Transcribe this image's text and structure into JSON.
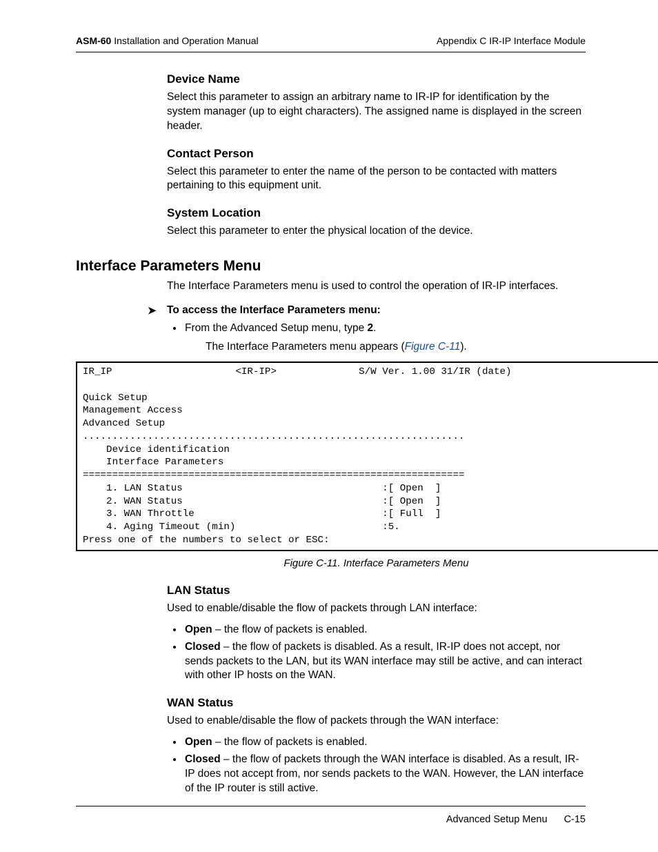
{
  "header": {
    "product": "ASM-60",
    "doc_title": "Installation and Operation Manual",
    "appendix": "Appendix C  IR-IP Interface Module"
  },
  "sections": {
    "device_name": {
      "title": "Device Name",
      "body": "Select this parameter to assign an arbitrary name to IR-IP for identification by the system manager (up to eight characters). The assigned name is displayed in the screen header."
    },
    "contact_person": {
      "title": "Contact Person",
      "body": "Select this parameter to enter the name of the person to be contacted with matters pertaining to this equipment unit."
    },
    "system_location": {
      "title": "System Location",
      "body": "Select this parameter to enter the physical location of the device."
    },
    "interface_params": {
      "title": "Interface Parameters Menu",
      "intro": "The Interface Parameters menu is used to control the operation of IR-IP interfaces.",
      "access_title": "To access the Interface Parameters menu:",
      "step_prefix": "From the Advanced Setup menu, type ",
      "step_key": "2",
      "step_suffix": ".",
      "result_prefix": "The Interface Parameters menu appears (",
      "figure_link": "Figure C-11",
      "result_suffix": ")."
    },
    "figure_caption": "Figure C-11.  Interface Parameters Menu",
    "lan_status": {
      "title": "LAN Status",
      "intro": "Used to enable/disable the flow of packets through LAN interface:",
      "open_term": "Open",
      "open_body": " – the flow of packets is enabled.",
      "closed_term": "Closed",
      "closed_body": " – the flow of packets is disabled. As a result, IR-IP does not accept, nor sends packets to the LAN, but its WAN interface may still be active, and can interact with other IP hosts on the WAN."
    },
    "wan_status": {
      "title": "WAN Status",
      "intro": "Used to enable/disable the flow of packets through the WAN interface:",
      "open_term": "Open",
      "open_body": " – the flow of packets is enabled.",
      "closed_term": "Closed",
      "closed_body": " – the flow of packets through the WAN interface is disabled. As a result, IR-IP does not accept from, nor sends packets to the WAN. However, the LAN interface of the IP router is still active."
    }
  },
  "terminal": "IR_IP                     <IR-IP>              S/W Ver. 1.00 31/IR (date)\n\nQuick Setup\nManagement Access\nAdvanced Setup\n.................................................................\n    Device identification\n    Interface Parameters\n=================================================================\n    1. LAN Status                                  :[ Open  ]\n    2. WAN Status                                  :[ Open  ]\n    3. WAN Throttle                                :[ Full  ]\n    4. Aging Timeout (min)                         :5.\nPress one of the numbers to select or ESC:",
  "footer": {
    "section": "Advanced Setup Menu",
    "page": "C-15"
  }
}
